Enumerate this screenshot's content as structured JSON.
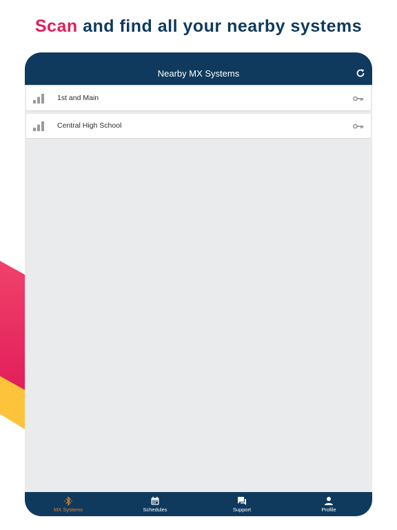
{
  "headline": {
    "accent": "Scan",
    "rest": " and find all your nearby systems"
  },
  "nav": {
    "title": "Nearby MX Systems",
    "refresh_icon": "refresh-icon"
  },
  "systems": [
    {
      "name": "1st and Main",
      "signal_icon": "signal-bars-icon",
      "key_icon": "key-icon"
    },
    {
      "name": "Central High School",
      "signal_icon": "signal-bars-icon",
      "key_icon": "key-icon"
    }
  ],
  "tabs": [
    {
      "label": "MX Systems",
      "icon": "bluetooth-icon",
      "active": true
    },
    {
      "label": "Schedules",
      "icon": "calendar-icon",
      "active": false
    },
    {
      "label": "Support",
      "icon": "chat-icon",
      "active": false
    },
    {
      "label": "Profile",
      "icon": "person-icon",
      "active": false
    }
  ],
  "colors": {
    "navy": "#0f3a5e",
    "accent_pink": "#e21f5a",
    "active_tab": "#e8822a",
    "background": "#e9ebed",
    "deco_yellow": "#fdc33a"
  }
}
